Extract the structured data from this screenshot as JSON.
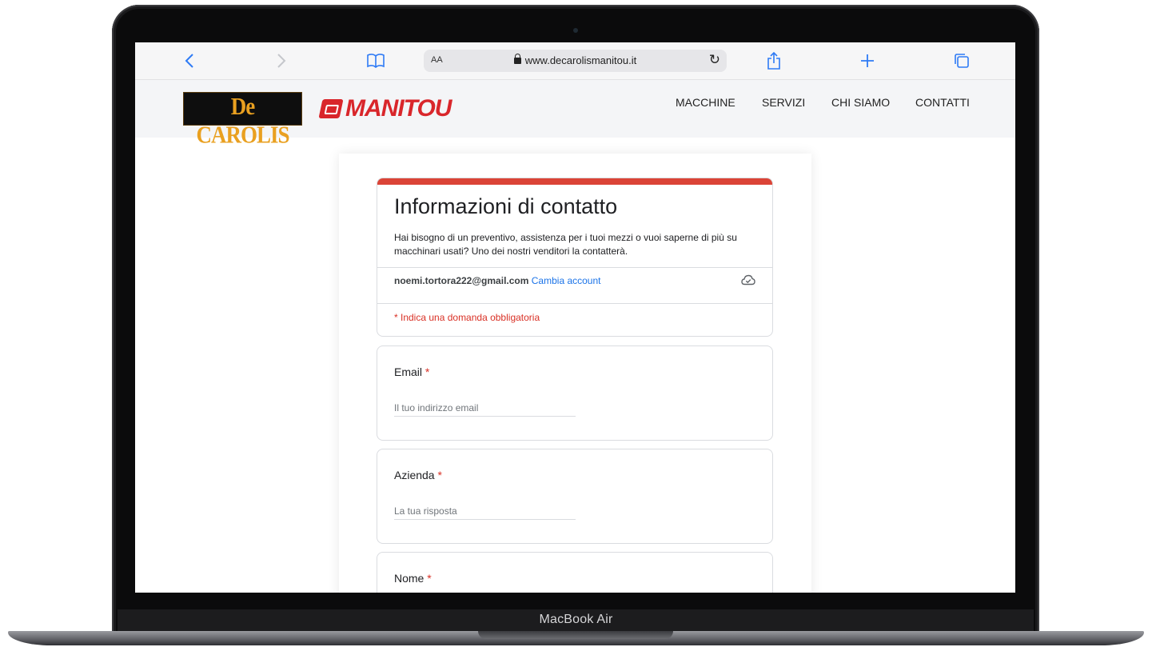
{
  "device": {
    "model_label": "MacBook Air"
  },
  "browser": {
    "text_size_label": "AA",
    "url": "www.decarolismanitou.it"
  },
  "site": {
    "logo_left": "De CAROLIS",
    "logo_right": "MANITOU",
    "nav": [
      "MACCHINE",
      "SERVIZI",
      "CHI SIAMO",
      "CONTATTI"
    ]
  },
  "form": {
    "title": "Informazioni di contatto",
    "description": "Hai bisogno di un preventivo, assistenza per i tuoi mezzi o vuoi saperne di più su macchinari usati? Uno dei nostri venditori la contatterà.",
    "account_email": "noemi.tortora222@gmail.com",
    "switch_account": "Cambia account",
    "required_note": "* Indica una domanda obbligatoria",
    "questions": [
      {
        "label": "Email",
        "required_mark": "*",
        "placeholder": "Il tuo indirizzo email"
      },
      {
        "label": "Azienda",
        "required_mark": "*",
        "placeholder": "La tua risposta"
      },
      {
        "label": "Nome",
        "required_mark": "*",
        "placeholder": ""
      }
    ]
  },
  "colors": {
    "accent": "#db4437",
    "link": "#1a73e8",
    "required": "#d93025",
    "safari_blue": "#2f7bf5"
  },
  "icons": [
    "back-icon",
    "forward-icon",
    "bookmarks-icon",
    "lock-icon",
    "reload-icon",
    "share-icon",
    "new-tab-icon",
    "tabs-icon",
    "cloud-saved-icon"
  ]
}
